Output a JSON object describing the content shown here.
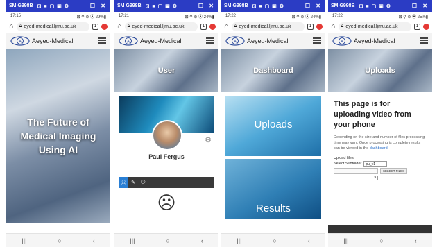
{
  "window": {
    "device": "SM G998B",
    "icons": "⊡ ■ ▢ ▣ ⚙",
    "controls": "– ☐ ✕"
  },
  "browser": {
    "url": "eyed-medical.ljmu.ac.uk",
    "tab_count": "1",
    "home_icon": "home-icon",
    "lock_icon": "lock-icon"
  },
  "site": {
    "brand": "Aeyed-Medical"
  },
  "phones": [
    {
      "status_time": "17:15",
      "status_right": "⊠ ⚲ ⊕ ⦿ 29%▮",
      "hero_title": "The Future of Medical Imaging Using AI"
    },
    {
      "status_time": "17:21",
      "status_right": "⊠ ⚲ ⊕ ⦿ 24%▮",
      "banner": "User",
      "profile_name": "Paul Fergus",
      "tab_icons": [
        "user-icon",
        "pencil-icon",
        "comment-icon"
      ],
      "empty_face": "☹"
    },
    {
      "status_time": "17:22",
      "status_right": "⊠ ⚲ ⊕ ⦿ 24%▮",
      "banner": "Dashboard",
      "tiles": [
        "Uploads",
        "Results"
      ]
    },
    {
      "status_time": "17:22",
      "status_right": "⊠ ⚲ ⊕ ⦿ 25%▮",
      "banner": "Uploads",
      "title": "This page is for uploading video from your phone",
      "description": "Depending on the size and number of files processing time may vary. Once processing is complete results can be viewed in the",
      "description_link": "dashboard",
      "upload_label": "Upload files",
      "subfolder_label": "Select Subfolder",
      "subfolder_value": "pu_v1",
      "select_files_label": "SELECT FILES",
      "dropdown_arrow": "▾"
    }
  ],
  "bottom_nav": {
    "recents": "|||",
    "home": "○",
    "back": "‹"
  },
  "colors": {
    "title_bar": "#2b3cc4",
    "link": "#2a6fc9",
    "active_tab": "#2a7fd4"
  }
}
